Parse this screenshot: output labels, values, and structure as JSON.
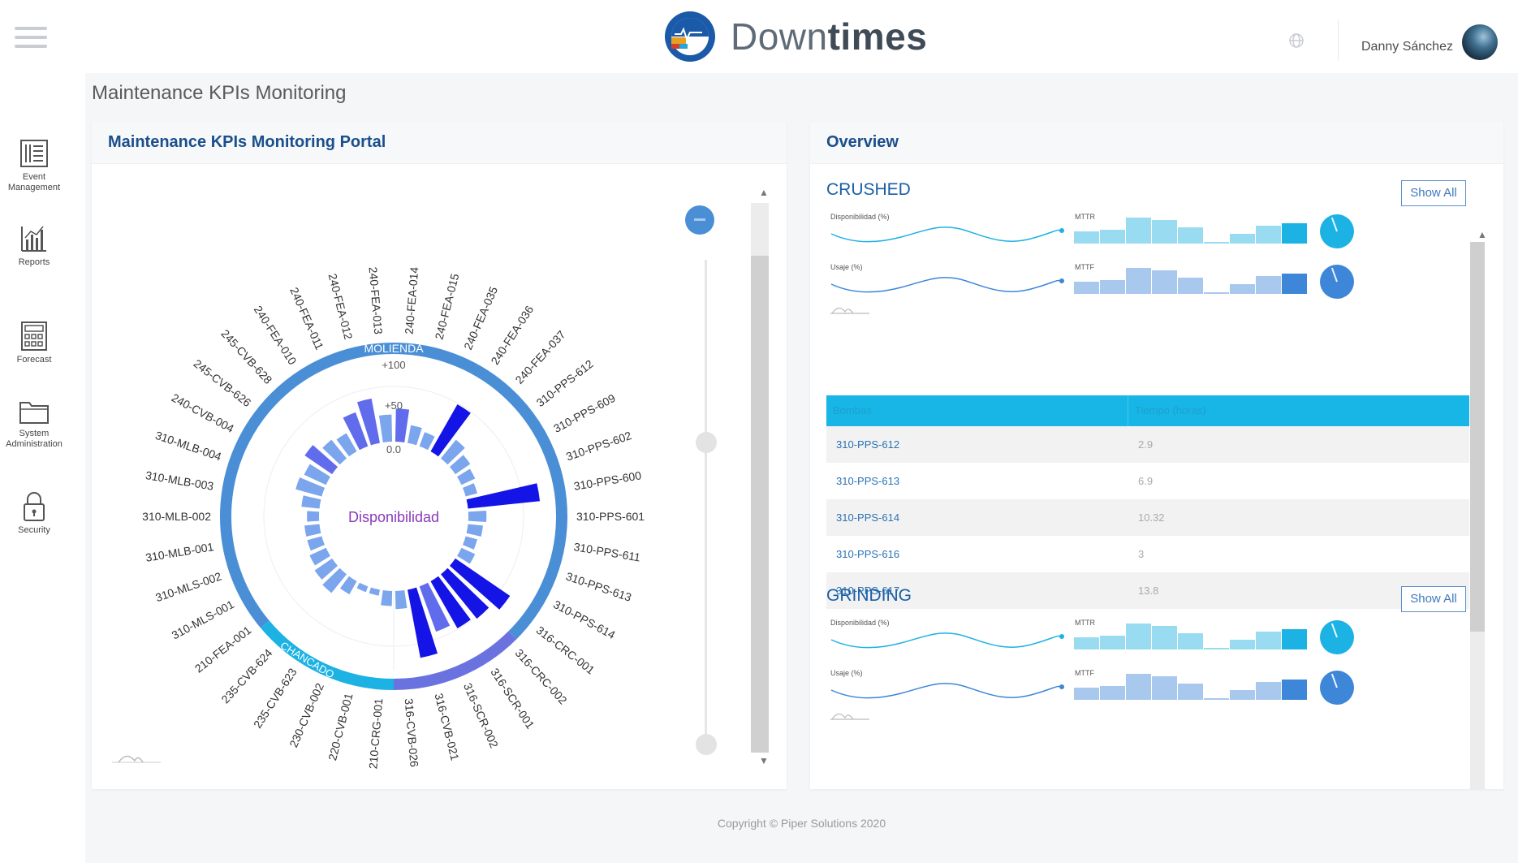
{
  "header": {
    "brand_light": "Down",
    "brand_bold": "times",
    "user_name": "Danny Sánchez"
  },
  "sidebar": {
    "items": [
      {
        "label_line1": "Event",
        "label_line2": "Management",
        "icon": "event-list-icon"
      },
      {
        "label_line1": "Reports",
        "label_line2": "",
        "icon": "bar-chart-icon"
      },
      {
        "label_line1": "Forecast",
        "label_line2": "",
        "icon": "calculator-icon"
      },
      {
        "label_line1": "System",
        "label_line2": "Administration",
        "icon": "folder-icon"
      },
      {
        "label_line1": "Security",
        "label_line2": "",
        "icon": "lock-icon"
      }
    ]
  },
  "page_title": "Maintenance KPIs Monitoring",
  "left_card": {
    "title": "Maintenance KPIs Monitoring Portal"
  },
  "chart_data": {
    "type": "radial-bar",
    "center_label": "Disponibilidad",
    "radial_ticks": [
      "0.0",
      "+50",
      "+100"
    ],
    "groups": [
      {
        "name": "MOLIENDA",
        "color": "#4a8fd6"
      },
      {
        "name": "CHANCADO",
        "color": "#1cb2e3"
      },
      {
        "name": "",
        "color": "#6a72e0"
      }
    ],
    "categories": [
      "240-FEA-014",
      "240-FEA-015",
      "240-FEA-035",
      "240-FEA-036",
      "240-FEA-037",
      "310-PPS-612",
      "310-PPS-609",
      "310-PPS-602",
      "310-PPS-600",
      "310-PPS-601",
      "310-PPS-611",
      "310-PPS-613",
      "310-PPS-614",
      "316-CRC-001",
      "316-CRC-002",
      "316-SCR-001",
      "316-SCR-002",
      "316-CVB-021",
      "316-CVB-026",
      "210-CRG-001",
      "220-CVB-001",
      "230-CVB-002",
      "235-CVB-623",
      "235-CVB-624",
      "210-FEA-001",
      "310-MLS-001",
      "310-MLS-002",
      "310-MLB-001",
      "310-MLB-002",
      "310-MLB-003",
      "310-MLB-004",
      "240-CVB-004",
      "245-CVB-626",
      "245-CVB-628",
      "240-FEA-010",
      "240-FEA-011",
      "240-FEA-012",
      "240-FEA-013"
    ],
    "values": [
      55,
      30,
      25,
      90,
      40,
      30,
      25,
      20,
      120,
      30,
      25,
      20,
      25,
      110,
      95,
      90,
      80,
      115,
      30,
      25,
      10,
      10,
      25,
      40,
      35,
      30,
      25,
      25,
      20,
      30,
      45,
      40,
      55,
      40,
      35,
      60,
      75,
      45
    ],
    "ylim": [
      0,
      120
    ]
  },
  "right_card": {
    "title": "Overview",
    "sections": [
      {
        "name": "CRUSHED",
        "show_all": "Show All",
        "rows": [
          {
            "spark_label": "Disponibilidad (%)",
            "bar_label": "MTTR",
            "color": "#1cb2e3"
          },
          {
            "spark_label": "Usaje (%)",
            "bar_label": "MTTF",
            "color": "#3d86d8"
          }
        ]
      },
      {
        "name": "GRINDING",
        "show_all": "Show All",
        "rows": [
          {
            "spark_label": "Disponibilidad (%)",
            "bar_label": "MTTR",
            "color": "#1cb2e3"
          },
          {
            "spark_label": "Usaje (%)",
            "bar_label": "MTTF",
            "color": "#3d86d8"
          }
        ]
      }
    ],
    "bar_values": [
      0.45,
      0.5,
      0.95,
      0.85,
      0.6,
      0.05,
      0.35,
      0.65,
      0.75
    ],
    "table": {
      "headers": [
        "Bombas",
        "Tiempo (horas)"
      ],
      "rows": [
        [
          "310-PPS-612",
          "2.9"
        ],
        [
          "310-PPS-613",
          "6.9"
        ],
        [
          "310-PPS-614",
          "10.32"
        ],
        [
          "310-PPS-616",
          "3"
        ],
        [
          "310-PPS-617",
          "13.8"
        ]
      ]
    }
  },
  "footer": "Copyright © Piper Solutions 2020"
}
